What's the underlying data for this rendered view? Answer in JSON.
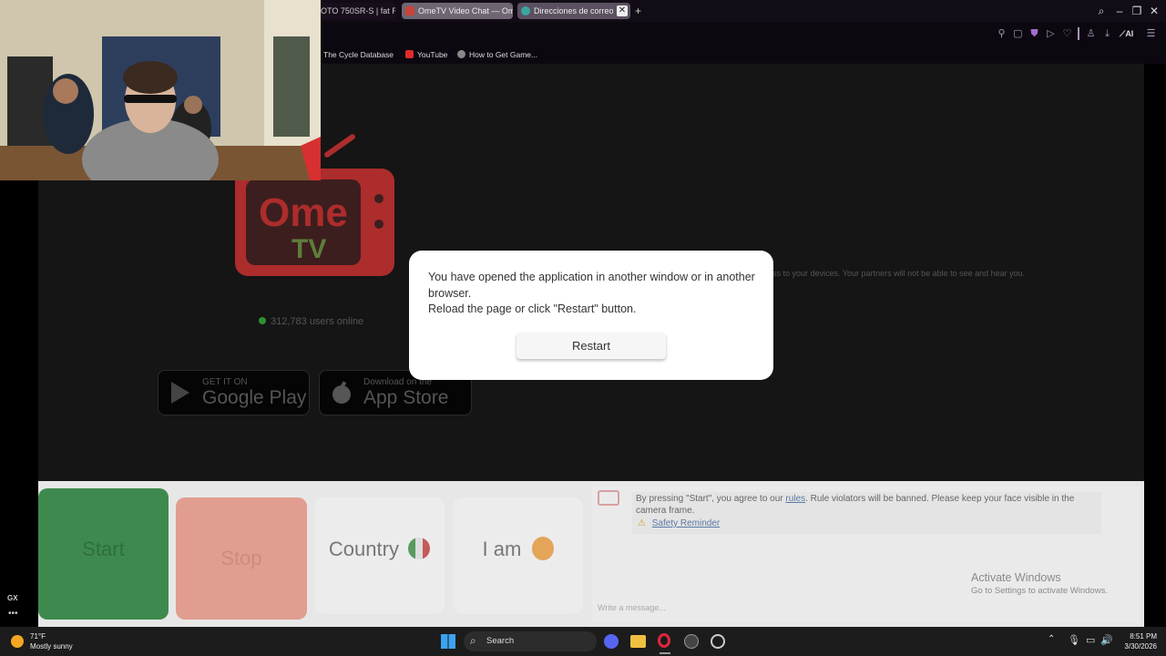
{
  "browser": {
    "tabs": [
      {
        "label": "OTO 750SR-S | fat R...",
        "active": false
      },
      {
        "label": "OmeTV Video Chat — Ome",
        "active": false
      },
      {
        "label": "Direcciones de correo",
        "active": true
      }
    ],
    "new_tab": "+",
    "bookmarks": [
      "The Cycle Database",
      "YouTube",
      "How to Get Game..."
    ],
    "toolbar_ai": "AI",
    "sidebar_label": "GX"
  },
  "page": {
    "logo_top": "Ome",
    "logo_bottom": "TV",
    "users_online": "312,783 users online",
    "google_play_small": "GET IT ON",
    "google_play_big": "Google Play",
    "app_store_small": "Download on the",
    "app_store_big": "App Store",
    "privacy_text": "ss to your devices. Your partners will not be able to see and hear you."
  },
  "controls": {
    "start": "Start",
    "stop": "Stop",
    "country": "Country",
    "iam": "I am"
  },
  "chat": {
    "notice_before": "By pressing \"Start\", you agree to our ",
    "notice_link": "rules",
    "notice_after": ". Rule violators will be banned. Please keep your face visible in the camera frame.",
    "safety": "Safety Reminder",
    "input_placeholder": "Write a message..."
  },
  "modal": {
    "line1": "You have opened the application in another window or in another browser.",
    "line2": "Reload the page or click \"Restart\" button.",
    "button": "Restart"
  },
  "watermark": {
    "title": "Activate Windows",
    "subtitle": "Go to Settings to activate Windows."
  },
  "taskbar": {
    "weather_temp": "71°F",
    "weather_desc": "Mostly sunny",
    "search": "Search",
    "time": "8:51 PM",
    "date": "3/30/2026"
  },
  "colors": {
    "start": "#3e8a4e",
    "stop": "#e19d8f",
    "brand_red": "#ad2c2c",
    "modal_bg": "#ffffff"
  }
}
